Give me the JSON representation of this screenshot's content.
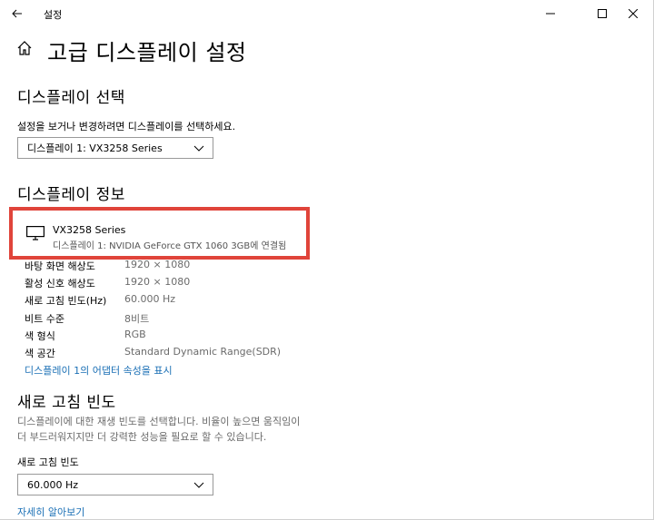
{
  "window": {
    "title": "설정"
  },
  "header": {
    "title": "고급 디스플레이 설정"
  },
  "select_display": {
    "heading": "디스플레이 선택",
    "instruction": "설정을 보거나 변경하려면 디스플레이를 선택하세요.",
    "selected": "디스플레이 1: VX3258 Series"
  },
  "display_info": {
    "heading": "디스플레이 정보",
    "monitor_name": "VX3258 Series",
    "connection": "디스플레이 1: NVIDIA GeForce GTX 1060 3GB에 연결됨",
    "rows": [
      {
        "label": "바탕 화면 해상도",
        "value": "1920 × 1080"
      },
      {
        "label": "활성 신호 해상도",
        "value": "1920 × 1080"
      },
      {
        "label": "새로 고침 빈도(Hz)",
        "value": "60.000 Hz"
      },
      {
        "label": "비트 수준",
        "value": "8비트"
      },
      {
        "label": "색 형식",
        "value": "RGB"
      },
      {
        "label": "색 공간",
        "value": "Standard Dynamic Range(SDR)"
      }
    ],
    "adapter_link": "디스플레이 1의 어댑터 속성을 표시"
  },
  "refresh_rate": {
    "heading": "새로 고침 빈도",
    "description_line1": "디스플레이에 대한 재생 빈도를 선택합니다. 비율이 높으면 움직임이",
    "description_line2": "더 부드러워지지만 더 강력한 성능을 필요로 할 수 있습니다.",
    "field_label": "새로 고침 빈도",
    "selected": "60.000 Hz",
    "learn_more": "자세히 알아보기"
  },
  "colors": {
    "accent": "#1a6fb5",
    "highlight_border": "#e0443a",
    "secondary_text": "#6b6b6b"
  }
}
